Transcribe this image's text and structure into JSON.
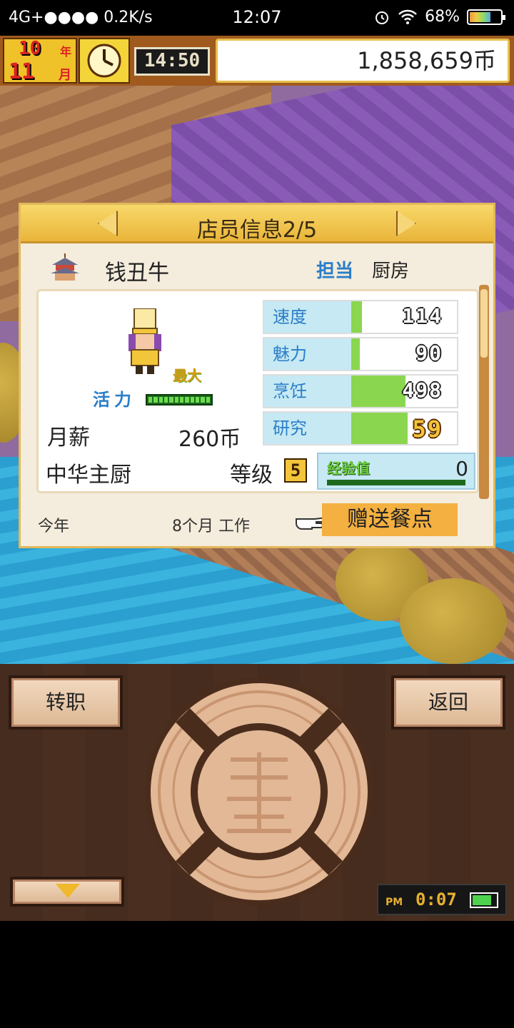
{
  "status_bar": {
    "network": "4G+●●●● 0.2K/s",
    "time": "12:07",
    "battery_percent": "68%"
  },
  "hud": {
    "year": "10",
    "year_suffix": "年",
    "month": "11",
    "month_suffix": "月",
    "game_time": "14:50",
    "money": "1,858,659币"
  },
  "dialog": {
    "title": "店员信息2/5",
    "staff_name": "钱丑牛",
    "assignment_label": "担当",
    "assignment_value": "厨房",
    "max_label": "最大",
    "vitality_label": "活力",
    "vitality_level": 1.0,
    "salary_label": "月薪",
    "salary_value": "260币",
    "stats": [
      {
        "name": "速度",
        "value": "114",
        "fill": 0.1
      },
      {
        "name": "魅力",
        "value": "90",
        "fill": 0.08
      },
      {
        "name": "烹饪",
        "value": "498",
        "fill": 0.5
      },
      {
        "name": "研究",
        "value": "59",
        "fill": 0.52
      }
    ],
    "rank": "中华主厨",
    "level_label": "等级",
    "level": "5",
    "exp_label": "经验值",
    "exp_value": "0",
    "tenure_label": "今年",
    "tenure_value": "8个月 工作",
    "gift_button": "赠送餐点"
  },
  "controls": {
    "transfer_button": "转职",
    "return_button": "返回",
    "time_chip_pm": "PM",
    "time_chip_value": "0:07"
  },
  "colors": {
    "accent_blue": "#2a7ec8",
    "gold": "#f3c53a",
    "stat_bar_green": "#8bd64f"
  }
}
